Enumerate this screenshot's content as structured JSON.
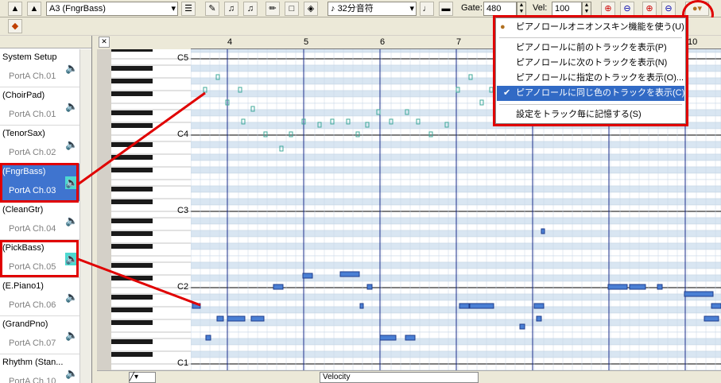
{
  "toolbar": {
    "track_select": "A3  (FngrBass)",
    "note_length": "32分音符",
    "gate_label": "Gate:",
    "gate_value": "480",
    "vel_label": "Vel:",
    "vel_value": "100"
  },
  "ruler": {
    "measures": [
      "4",
      "5",
      "6",
      "7",
      "10"
    ]
  },
  "piano": {
    "octave_labels": [
      "C5",
      "C4",
      "C3",
      "C2",
      "C1"
    ]
  },
  "tracks": [
    {
      "name": "System Setup",
      "port": "PortA  Ch.01"
    },
    {
      "name": "(ChoirPad)",
      "port": "PortA  Ch.01"
    },
    {
      "name": "(TenorSax)",
      "port": "PortA  Ch.02"
    },
    {
      "name": "(FngrBass)",
      "port": "PortA  Ch.03"
    },
    {
      "name": "(CleanGtr)",
      "port": "PortA  Ch.04"
    },
    {
      "name": "(PickBass)",
      "port": "PortA  Ch.05"
    },
    {
      "name": "(E.Piano1)",
      "port": "PortA  Ch.06"
    },
    {
      "name": "(GrandPno)",
      "port": "PortA  Ch.07"
    },
    {
      "name": "Rhythm (Stan...",
      "port": "PortA  Ch.10"
    }
  ],
  "menu": {
    "items": [
      {
        "label": "ピアノロールオニオンスキン機能を使う(U)",
        "checked": false,
        "selected": false
      },
      {
        "label": "ピアノロールに前のトラックを表示(P)",
        "checked": false,
        "selected": false
      },
      {
        "label": "ピアノロールに次のトラックを表示(N)",
        "checked": false,
        "selected": false
      },
      {
        "label": "ピアノロールに指定のトラックを表示(O)...",
        "checked": false,
        "selected": false
      },
      {
        "label": "ピアノロールに同じ色のトラックを表示(C)",
        "checked": true,
        "selected": true
      },
      {
        "label": "設定をトラック毎に記憶する(S)",
        "checked": false,
        "selected": false
      }
    ]
  },
  "bottom": {
    "controller": "Velocity"
  },
  "colors": {
    "highlight": "#e00000",
    "selection": "#316ac5",
    "note_fill": "#4a7fd4",
    "ghost_note": "#3fa89a"
  }
}
